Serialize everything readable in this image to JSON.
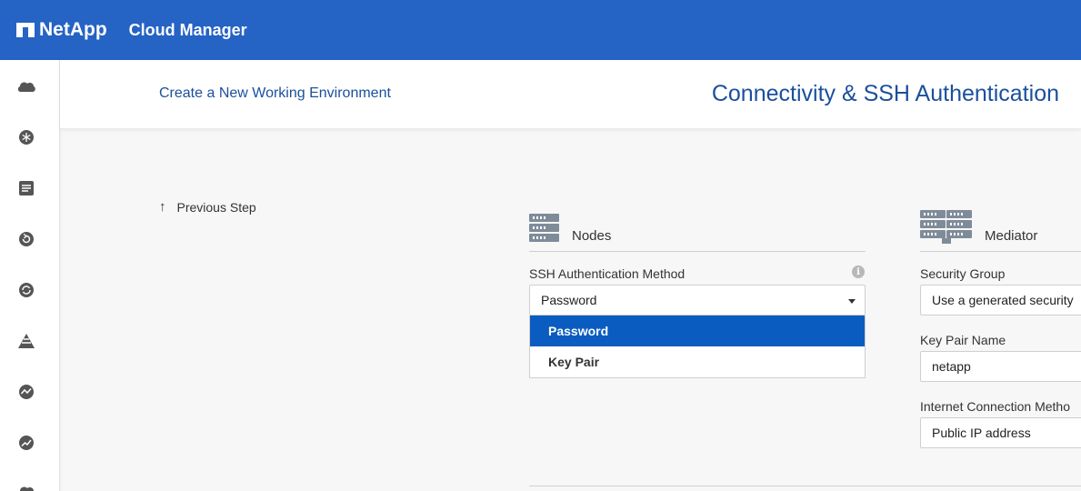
{
  "topbar": {
    "brand": "NetApp",
    "product": "Cloud Manager"
  },
  "leftnav": {
    "icons": [
      "cloud-icon",
      "snowflake-icon",
      "list-icon",
      "backup-icon",
      "sync-icon",
      "tiering-icon",
      "monitor-icon",
      "analytics-icon"
    ]
  },
  "header": {
    "breadcrumb": "Create a New Working Environment",
    "title": "Connectivity & SSH Authentication"
  },
  "prev_step": {
    "arrow": "↑",
    "label": "Previous Step"
  },
  "nodes": {
    "title": "Nodes",
    "ssh_label": "SSH Authentication Method",
    "ssh_value": "Password",
    "options": [
      "Password",
      "Key Pair"
    ],
    "selected_option": "Password"
  },
  "mediator": {
    "title": "Mediator",
    "security_group_label": "Security Group",
    "security_group_value": "Use a generated security",
    "key_pair_label": "Key Pair Name",
    "key_pair_value": "netapp",
    "internet_label": "Internet Connection Metho",
    "internet_value": "Public IP address"
  },
  "colors": {
    "topbar": "#2563c4",
    "accent": "#0b5cc0",
    "link": "#1b4f9c"
  }
}
